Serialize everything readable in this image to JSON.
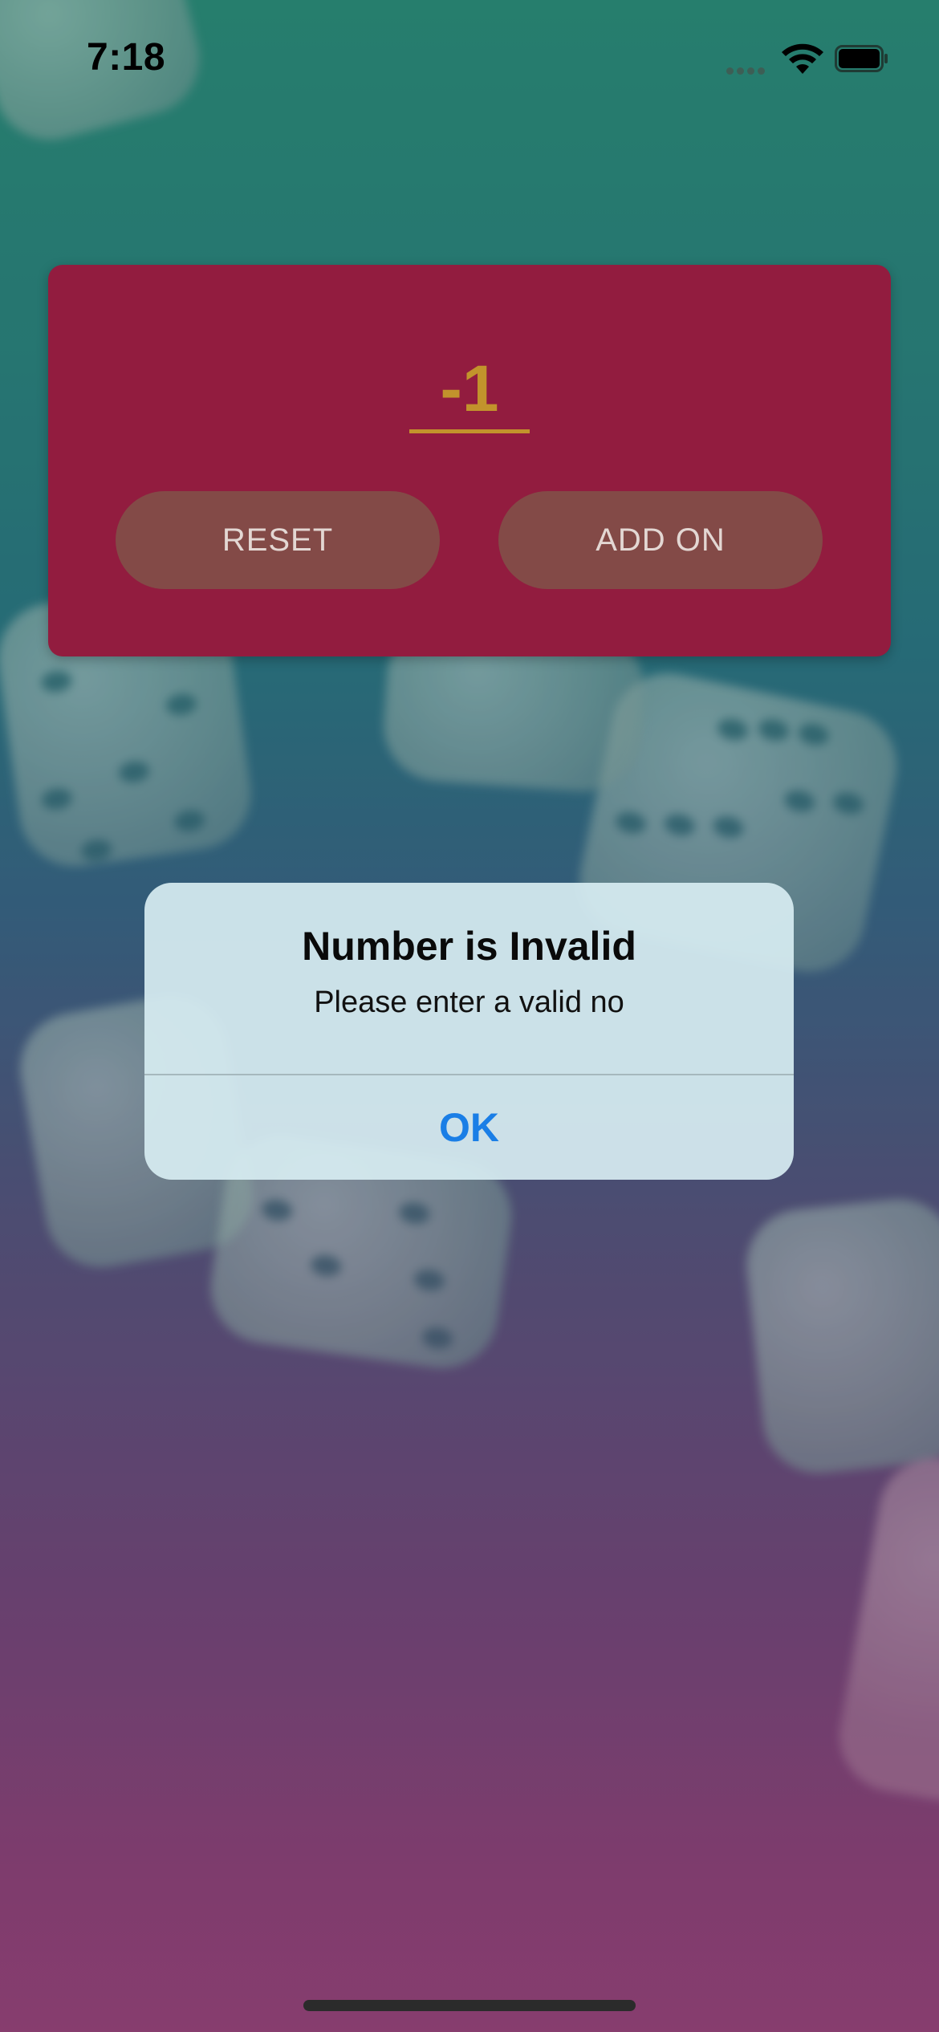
{
  "status_bar": {
    "time": "7:18"
  },
  "card": {
    "number_value": "-1",
    "reset_label": "RESET",
    "add_on_label": "ADD ON"
  },
  "alert": {
    "title": "Number is Invalid",
    "message": "Please enter a valid no",
    "ok_label": "OK"
  },
  "colors": {
    "card_bg": "#921c3f",
    "number_accent": "#c2932c",
    "button_bg": "#834a47",
    "alert_action": "#1a7ee6"
  },
  "icons": [
    "signal-icon",
    "wifi-icon",
    "battery-icon"
  ]
}
